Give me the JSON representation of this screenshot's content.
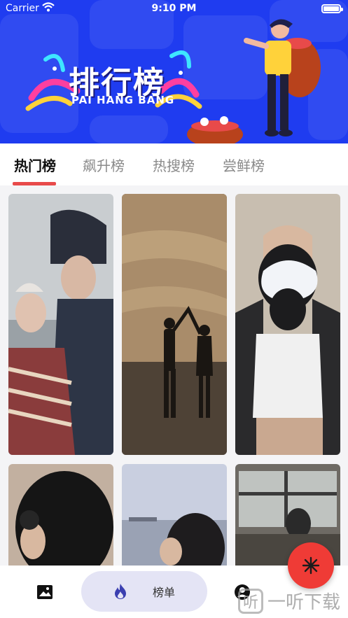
{
  "status_bar": {
    "carrier": "Carrier",
    "time": "9:10 PM"
  },
  "banner": {
    "title": "排行榜",
    "subtitle": "PAI HANG BANG",
    "background_color": "#1f3cf0"
  },
  "tabs": [
    {
      "label": "热门榜",
      "active": true
    },
    {
      "label": "飙升榜",
      "active": false
    },
    {
      "label": "热搜榜",
      "active": false
    },
    {
      "label": "尝鲜榜",
      "active": false
    }
  ],
  "accent_color": "#e84a4a",
  "photos": [
    {
      "subject": "couple-winter-photo"
    },
    {
      "subject": "couple-beach-sunset-photo"
    },
    {
      "subject": "woman-scrunchie-photo"
    },
    {
      "subject": "woman-dark-hair-photo"
    },
    {
      "subject": "woman-seaside-photo"
    },
    {
      "subject": "bus-window-photo"
    }
  ],
  "bottom_nav": {
    "items": [
      {
        "icon": "image-icon",
        "label": ""
      },
      {
        "icon": "flame-icon",
        "label": "榜单"
      },
      {
        "icon": "user-icon",
        "label": ""
      }
    ]
  },
  "fab": {
    "icon": "snowflake-icon",
    "color": "#ef3b36"
  },
  "watermark": {
    "text": "一听下载"
  }
}
